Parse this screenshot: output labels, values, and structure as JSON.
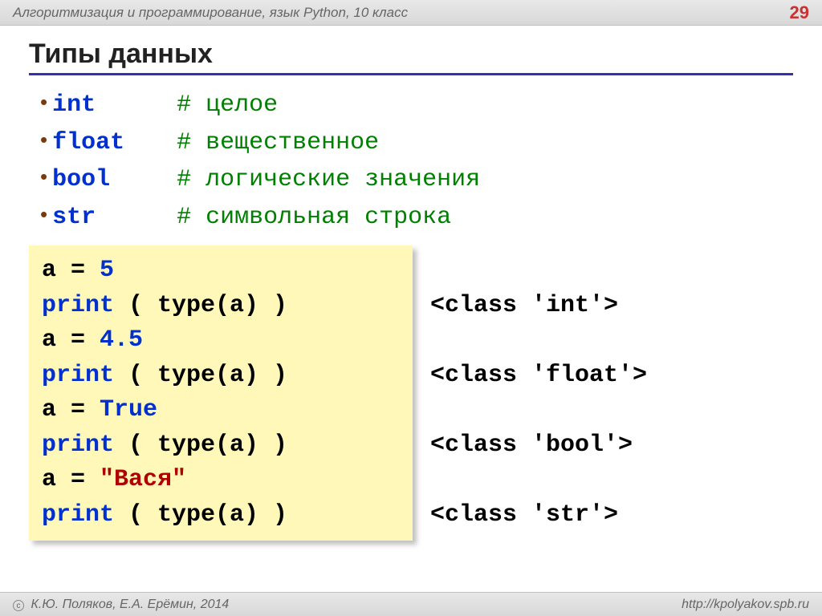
{
  "header": {
    "title": "Алгоритмизация и программирование, язык Python, 10 класс",
    "page": "29"
  },
  "title": "Типы данных",
  "types": [
    {
      "name": "int",
      "comment": "# целое"
    },
    {
      "name": "float",
      "comment": "# вещественное"
    },
    {
      "name": "bool",
      "comment": "# логические значения"
    },
    {
      "name": "str",
      "comment": "# символьная строка"
    }
  ],
  "code": {
    "l1_a": "a",
    "l1_eq": " = ",
    "l1_v": "5",
    "l2_p": "print",
    "l2_r": " ( type(a) )",
    "l3_a": "a",
    "l3_eq": " = ",
    "l3_v": "4.5",
    "l4_p": "print",
    "l4_r": " ( type(a) )",
    "l5_a": "a",
    "l5_eq": " = ",
    "l5_v": "True",
    "l6_p": "print",
    "l6_r": " ( type(a) )",
    "l7_a": "a",
    "l7_eq": " = ",
    "l7_v": "\"Вася\"",
    "l8_p": "print",
    "l8_r": " ( type(a) )"
  },
  "output": {
    "o1": "<class 'int'>",
    "o2": "<class 'float'>",
    "o3": "<class 'bool'>",
    "o4": "<class 'str'>"
  },
  "footer": {
    "left": "К.Ю. Поляков, Е.А. Ерёмин, 2014",
    "right": "http://kpolyakov.spb.ru"
  }
}
